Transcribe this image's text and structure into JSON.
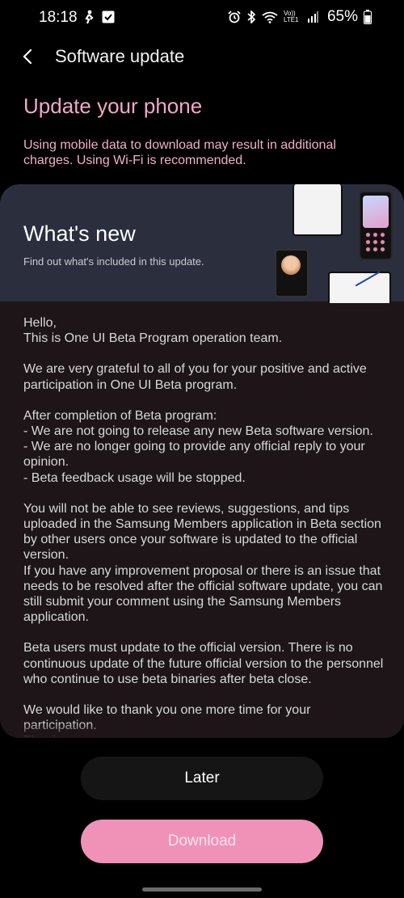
{
  "status_bar": {
    "time": "18:18",
    "volte": "Vo)) LTE1",
    "battery": "65%"
  },
  "header": {
    "title": "Software update"
  },
  "update": {
    "heading": "Update your phone",
    "warning": "Using mobile data to download may result in additional charges. Using Wi-Fi is recommended."
  },
  "whats_new": {
    "title": "What's new",
    "subtitle": "Find out what's included in this update.",
    "paragraphs": [
      "Hello,\nThis is One UI Beta Program operation team.",
      "We are very grateful to all of you for your positive and active participation in One UI Beta program.",
      "After completion of Beta program:\n- We are not going to release any new Beta software version.\n- We are no longer going to provide any official reply to your opinion.\n- Beta feedback usage will be stopped.",
      "You will not be able to see reviews, suggestions, and tips uploaded in the Samsung Members application in Beta section by other users once your software is updated to the official version.\nIf you have any improvement proposal or there is an issue that needs to be resolved after the official software update, you can still submit your comment using the Samsung Members application.",
      "Beta users must update to the official version. There is no continuous update of the future official version to the personnel who continue to use beta binaries after beta close.",
      "We would like to thank you one more time for your participation.\nThanks."
    ]
  },
  "buttons": {
    "later": "Later",
    "download": "Download"
  },
  "colors": {
    "accent_pink": "#f0a8c8",
    "download_button": "#f092b7",
    "card_background": "#1d1517",
    "banner_background": "#2b2e3c"
  }
}
